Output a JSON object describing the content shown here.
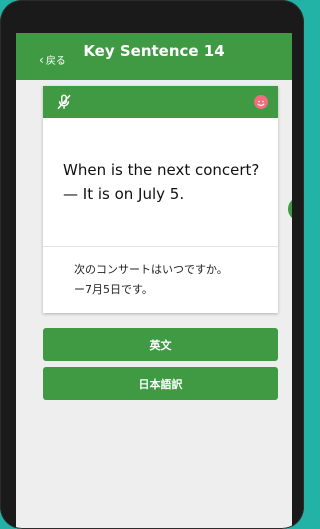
{
  "header": {
    "back_label": "戻る",
    "title": "Key Sentence 14"
  },
  "card": {
    "mute_icon": "mute-mic-icon",
    "face_icon": "smile-icon",
    "english_line1": "When is the next concert?",
    "english_line2": "— It is on July 5.",
    "japanese_line1": "次のコンサートはいつですか。",
    "japanese_line2": "ー7月5日です。"
  },
  "buttons": {
    "english_label": "英文",
    "japanese_label": "日本語訳"
  },
  "colors": {
    "brand_green": "#3f9a43",
    "background_teal": "#22b3a6",
    "accent_pink": "#f26d7d"
  }
}
